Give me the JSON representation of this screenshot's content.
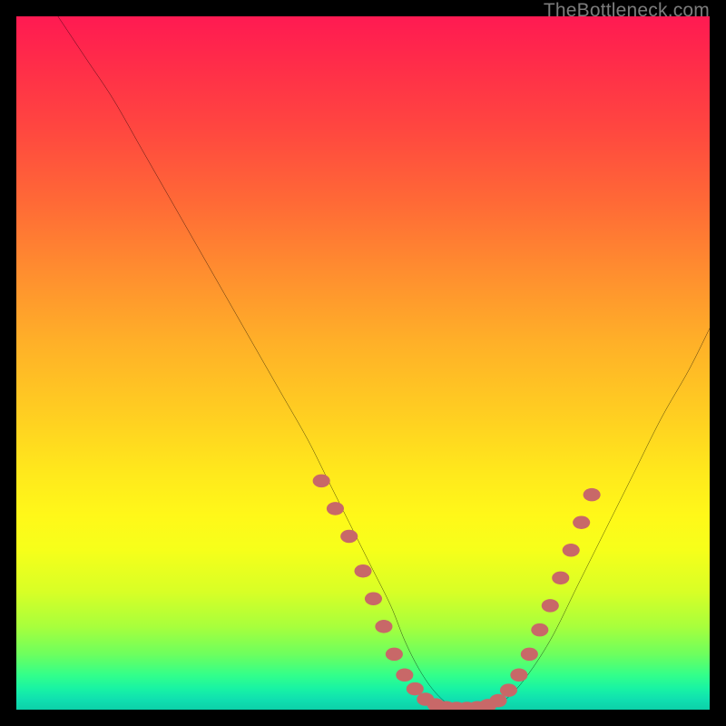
{
  "watermark": {
    "text": "TheBottleneck.com"
  },
  "colors": {
    "background": "#000000",
    "curve_stroke": "#000000",
    "marker_fill": "#c86868",
    "watermark_text": "#7c7c7c"
  },
  "chart_data": {
    "type": "line",
    "title": "",
    "xlabel": "",
    "ylabel": "",
    "xlim": [
      0,
      100
    ],
    "ylim": [
      0,
      100
    ],
    "grid": false,
    "curve": {
      "x": [
        6,
        10,
        14,
        18,
        22,
        26,
        30,
        34,
        38,
        42,
        45,
        48,
        51,
        54,
        56,
        58,
        60,
        62,
        64,
        66,
        68,
        70,
        73,
        77,
        81,
        85,
        89,
        93,
        97,
        100
      ],
      "y": [
        100,
        94,
        88,
        81,
        74,
        67,
        60,
        53,
        46,
        39,
        33,
        27,
        21,
        15,
        10,
        6,
        3,
        1,
        0,
        0,
        0,
        1,
        4,
        10,
        18,
        26,
        34,
        42,
        49,
        55
      ]
    },
    "markers": [
      {
        "x": 44,
        "y": 33
      },
      {
        "x": 46,
        "y": 29
      },
      {
        "x": 48,
        "y": 25
      },
      {
        "x": 50,
        "y": 20
      },
      {
        "x": 51.5,
        "y": 16
      },
      {
        "x": 53,
        "y": 12
      },
      {
        "x": 54.5,
        "y": 8
      },
      {
        "x": 56,
        "y": 5
      },
      {
        "x": 57.5,
        "y": 3
      },
      {
        "x": 59,
        "y": 1.5
      },
      {
        "x": 60.5,
        "y": 0.7
      },
      {
        "x": 62,
        "y": 0.3
      },
      {
        "x": 63.5,
        "y": 0.2
      },
      {
        "x": 65,
        "y": 0.2
      },
      {
        "x": 66.5,
        "y": 0.3
      },
      {
        "x": 68,
        "y": 0.6
      },
      {
        "x": 69.5,
        "y": 1.3
      },
      {
        "x": 71,
        "y": 2.8
      },
      {
        "x": 72.5,
        "y": 5
      },
      {
        "x": 74,
        "y": 8
      },
      {
        "x": 75.5,
        "y": 11.5
      },
      {
        "x": 77,
        "y": 15
      },
      {
        "x": 78.5,
        "y": 19
      },
      {
        "x": 80,
        "y": 23
      },
      {
        "x": 81.5,
        "y": 27
      },
      {
        "x": 83,
        "y": 31
      }
    ]
  }
}
